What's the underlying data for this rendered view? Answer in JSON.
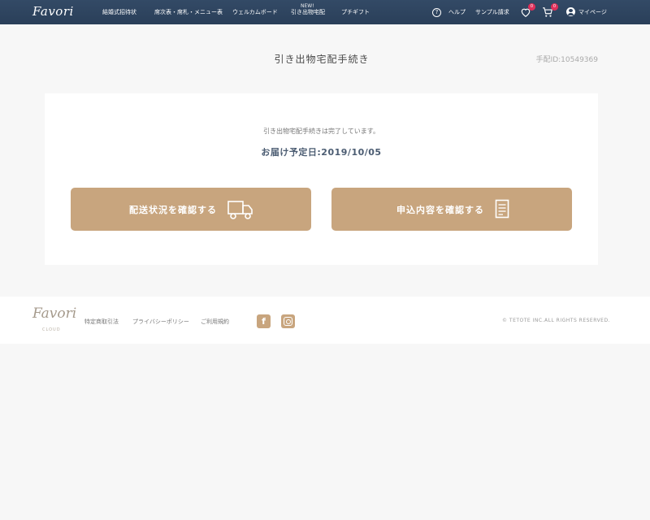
{
  "header": {
    "logo": "Favori",
    "nav": [
      {
        "label": "結婚式招待状"
      },
      {
        "label": "席次表・席札・メニュー表"
      },
      {
        "label": "ウェルカムボード"
      },
      {
        "label": "引き出物宅配",
        "badge": "NEW!"
      },
      {
        "label": "プチギフト"
      }
    ],
    "help_label": "ヘルプ",
    "sample_label": "サンプル請求",
    "favorites_count": "0",
    "cart_count": "0",
    "mypage_label": "マイページ"
  },
  "main": {
    "title": "引き出物宅配手続き",
    "order_id": "手配ID:10549369",
    "status_text": "引き出物宅配手続きは完了しています。",
    "delivery_date": "お届け予定日:2019/10/05",
    "buttons": {
      "shipping_status": "配送状況を確認する",
      "application_details": "申込内容を確認する"
    }
  },
  "footer": {
    "logo": "Favori",
    "logo_sub": "CLOUD",
    "links": [
      "特定商取引法",
      "プライバシーポリシー",
      "ご利用規約"
    ],
    "facebook": "f",
    "copyright": "© TETOTE INC.ALL RIGHTS RESERVED."
  },
  "colors": {
    "header_bg": "#2e4460",
    "button_bg": "#c8a57e",
    "badge": "#e0305a",
    "page_bg": "#f7f7f7"
  },
  "icons": [
    "help-icon",
    "heart-icon",
    "cart-icon",
    "user-icon",
    "truck-icon",
    "document-icon",
    "facebook-icon",
    "instagram-icon"
  ]
}
